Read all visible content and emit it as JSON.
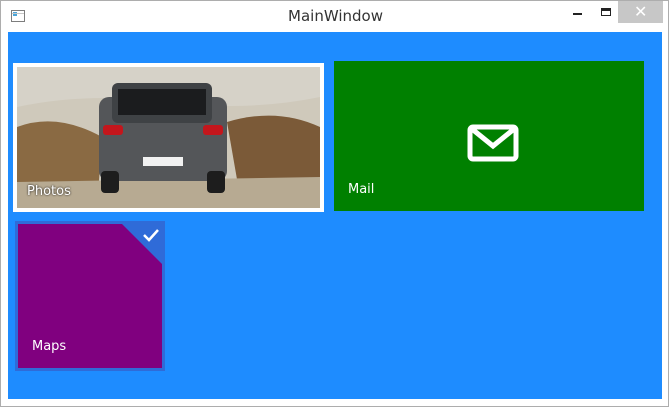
{
  "window": {
    "title": "MainWindow"
  },
  "tiles": [
    {
      "label": "Photos"
    },
    {
      "label": "Mail"
    },
    {
      "label": "Maps"
    }
  ],
  "colors": {
    "background": "#1e8cff",
    "mail_tile": "#008000",
    "maps_tile": "#80007f",
    "selection": "#2f6bd8"
  },
  "icons": {
    "app": "window-icon",
    "minimize": "minimize-icon",
    "maximize": "maximize-icon",
    "close": "close-icon",
    "mail": "envelope-icon",
    "selected": "checkmark-icon"
  }
}
